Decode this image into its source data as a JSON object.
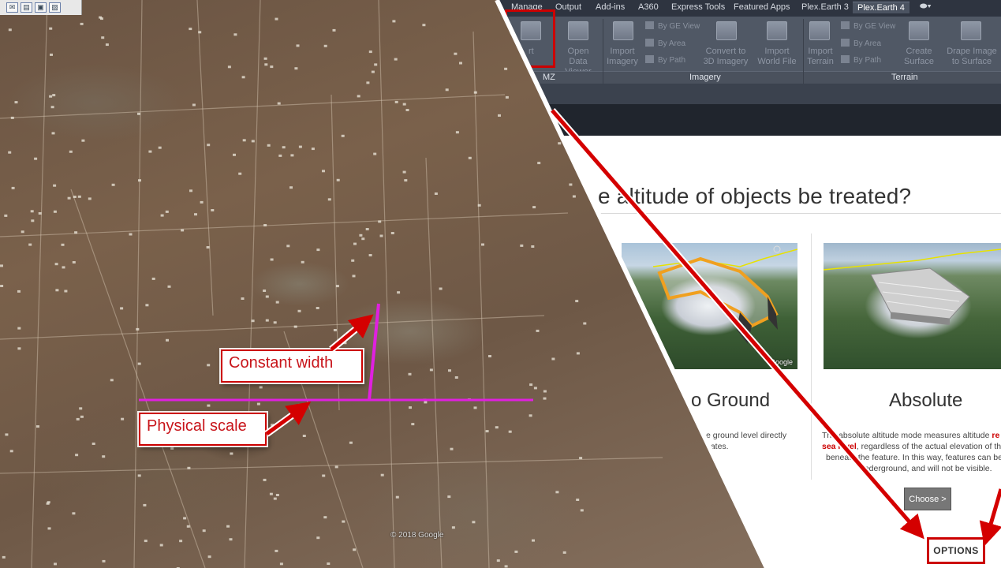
{
  "ribbon": {
    "tabs": [
      "Manage",
      "Output",
      "Add-ins",
      "A360",
      "Express Tools",
      "Featured Apps",
      "Plex.Earth 3",
      "Plex.Earth 4"
    ],
    "active_tab": "Plex.Earth 4",
    "buttons": {
      "kmz_top": "rt",
      "kmz_bottom": "MZ",
      "open_data_viewer_top": "Open",
      "open_data_viewer_bottom": "Data Viewer",
      "import_imagery_top": "Import",
      "import_imagery_bottom": "Imagery",
      "by_ge_view": "By GE View",
      "by_area": "By Area",
      "by_path": "By Path",
      "convert_3d_top": "Convert to",
      "convert_3d_bottom": "3D Imagery",
      "import_world_top": "Import",
      "import_world_bottom": "World File",
      "import_terrain_top": "Import",
      "import_terrain_bottom": "Terrain",
      "terrain_by_ge_view": "By GE View",
      "terrain_by_area": "By Area",
      "terrain_by_path": "By Path",
      "create_surface_top": "Create",
      "create_surface_bottom": "Surface",
      "drape_image_top": "Drape Image",
      "drape_image_bottom": "to Surface"
    },
    "panel_labels": {
      "kmz": "MZ",
      "imagery": "Imagery",
      "terrain": "Terrain"
    }
  },
  "map": {
    "callout_constant_width": "Constant width",
    "callout_physical_scale": "Physical scale",
    "copyright": "© 2018 Google"
  },
  "dialog": {
    "title": "e altitude of objects be treated?",
    "mode_ground": {
      "title": "o Ground",
      "desc_line1": "e ground level directly",
      "desc_line2": "nates."
    },
    "mode_absolute": {
      "title": "Absolute",
      "desc_line1_a": "The absolute altitude mode measures altitude ",
      "desc_line1_b": "re",
      "desc_line2_a": "sea level",
      "desc_line2_b": ", regardless of the actual elevation of th",
      "desc_line3": "beneath the feature. In this way, features can be",
      "desc_line4": "underground, and will not be visible."
    },
    "choose_button": "Choose >",
    "options_button": "OPTIONS",
    "thumb_google": "Google"
  },
  "colors": {
    "accent_red": "#c00000",
    "magenta": "#e020e0",
    "ribbon_dark": "#2e3440"
  }
}
